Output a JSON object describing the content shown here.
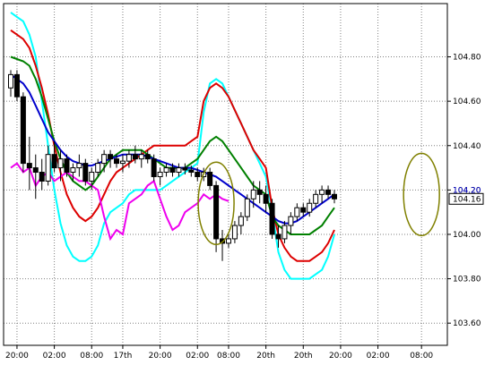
{
  "chart_data": {
    "type": "candlestick",
    "ylim": [
      103.5,
      105.04
    ],
    "y_ticks": [
      {
        "value": 104.8,
        "label": "104.80"
      },
      {
        "value": 104.6,
        "label": "104.60"
      },
      {
        "value": 104.4,
        "label": "104.40"
      },
      {
        "value": 104.2,
        "label": "104.20"
      },
      {
        "value": 104.0,
        "label": "104.00"
      },
      {
        "value": 103.8,
        "label": "103.80"
      },
      {
        "value": 103.6,
        "label": "103.60"
      }
    ],
    "x_ticks": [
      {
        "index": 1,
        "label": "20:00"
      },
      {
        "index": 7,
        "label": "02:00"
      },
      {
        "index": 13,
        "label": "08:00"
      },
      {
        "index": 18,
        "label": "17th"
      },
      {
        "index": 24,
        "label": "20:00"
      },
      {
        "index": 30,
        "label": "02:00"
      },
      {
        "index": 35,
        "label": "08:00"
      },
      {
        "index": 41,
        "label": "20th"
      },
      {
        "index": 47,
        "label": "20th"
      },
      {
        "index": 53,
        "label": "20:00"
      },
      {
        "index": 59,
        "label": "02:00"
      },
      {
        "index": 66,
        "label": "08:00"
      }
    ],
    "n_slots": 70,
    "last_price": {
      "value": 104.16,
      "label": "104.16"
    },
    "reference_price": {
      "value": 104.2,
      "label": "104.20"
    },
    "candles": [
      [
        104.66,
        104.74,
        104.62,
        104.72
      ],
      [
        104.72,
        104.74,
        104.6,
        104.62
      ],
      [
        104.62,
        104.64,
        104.28,
        104.32
      ],
      [
        104.32,
        104.44,
        104.2,
        104.3
      ],
      [
        104.3,
        104.36,
        104.16,
        104.28
      ],
      [
        104.28,
        104.34,
        104.2,
        104.24
      ],
      [
        104.24,
        104.4,
        104.22,
        104.36
      ],
      [
        104.36,
        104.42,
        104.28,
        104.3
      ],
      [
        104.3,
        104.38,
        104.24,
        104.34
      ],
      [
        104.34,
        104.36,
        104.26,
        104.28
      ],
      [
        104.28,
        104.32,
        104.24,
        104.3
      ],
      [
        104.3,
        104.36,
        104.26,
        104.32
      ],
      [
        104.32,
        104.34,
        104.22,
        104.24
      ],
      [
        104.24,
        104.3,
        104.2,
        104.28
      ],
      [
        104.28,
        104.34,
        104.26,
        104.32
      ],
      [
        104.32,
        104.38,
        104.28,
        104.36
      ],
      [
        104.36,
        104.38,
        104.3,
        104.34
      ],
      [
        104.34,
        104.36,
        104.3,
        104.32
      ],
      [
        104.32,
        104.36,
        104.28,
        104.33
      ],
      [
        104.33,
        104.38,
        104.3,
        104.36
      ],
      [
        104.36,
        104.4,
        104.32,
        104.34
      ],
      [
        104.34,
        104.38,
        104.3,
        104.36
      ],
      [
        104.36,
        104.38,
        104.32,
        104.34
      ],
      [
        104.34,
        104.36,
        104.24,
        104.26
      ],
      [
        104.26,
        104.3,
        104.22,
        104.28
      ],
      [
        104.28,
        104.32,
        104.26,
        104.3
      ],
      [
        104.3,
        104.32,
        104.26,
        104.28
      ],
      [
        104.28,
        104.32,
        104.26,
        104.3
      ],
      [
        104.3,
        104.32,
        104.27,
        104.29
      ],
      [
        104.29,
        104.31,
        104.26,
        104.28
      ],
      [
        104.28,
        104.3,
        104.24,
        104.26
      ],
      [
        104.26,
        104.3,
        104.24,
        104.28
      ],
      [
        104.28,
        104.3,
        104.2,
        104.22
      ],
      [
        104.22,
        104.24,
        103.92,
        103.98
      ],
      [
        103.98,
        104.02,
        103.88,
        103.96
      ],
      [
        103.96,
        104.0,
        103.94,
        103.98
      ],
      [
        103.98,
        104.06,
        103.96,
        104.04
      ],
      [
        104.04,
        104.1,
        104.0,
        104.08
      ],
      [
        104.08,
        104.18,
        104.06,
        104.16
      ],
      [
        104.16,
        104.24,
        104.12,
        104.2
      ],
      [
        104.2,
        104.24,
        104.14,
        104.18
      ],
      [
        104.18,
        104.22,
        104.1,
        104.14
      ],
      [
        104.14,
        104.16,
        103.98,
        104.0
      ],
      [
        104.0,
        104.04,
        103.94,
        103.98
      ],
      [
        103.98,
        104.06,
        103.96,
        104.04
      ],
      [
        104.04,
        104.1,
        104.0,
        104.08
      ],
      [
        104.08,
        104.14,
        104.06,
        104.12
      ],
      [
        104.12,
        104.14,
        104.08,
        104.1
      ],
      [
        104.1,
        104.16,
        104.08,
        104.14
      ],
      [
        104.14,
        104.2,
        104.12,
        104.18
      ],
      [
        104.18,
        104.22,
        104.14,
        104.2
      ],
      [
        104.2,
        104.22,
        104.16,
        104.18
      ],
      [
        104.18,
        104.2,
        104.14,
        104.16
      ]
    ],
    "series": [
      {
        "color": "#00ffff",
        "values": [
          105.0,
          104.98,
          104.96,
          104.9,
          104.8,
          104.6,
          104.4,
          104.2,
          104.05,
          103.95,
          103.9,
          103.88,
          103.88,
          103.9,
          103.95,
          104.05,
          104.1,
          104.12,
          104.14,
          104.18,
          104.2,
          104.2,
          104.2,
          104.2,
          104.2,
          104.22,
          104.24,
          104.26,
          104.28,
          104.3,
          104.32,
          104.55,
          104.68,
          104.7,
          104.68,
          104.62,
          104.56,
          104.5,
          104.44,
          104.38,
          104.32,
          104.26,
          104.1,
          103.92,
          103.84,
          103.8,
          103.8,
          103.8,
          103.8,
          103.82,
          103.84,
          103.9,
          104.0
        ]
      },
      {
        "color": "#dd0000",
        "values": [
          104.92,
          104.9,
          104.88,
          104.84,
          104.76,
          104.66,
          104.54,
          104.4,
          104.28,
          104.18,
          104.12,
          104.08,
          104.06,
          104.08,
          104.12,
          104.18,
          104.24,
          104.28,
          104.3,
          104.32,
          104.34,
          104.36,
          104.38,
          104.4,
          104.4,
          104.4,
          104.4,
          104.4,
          104.4,
          104.42,
          104.44,
          104.6,
          104.66,
          104.68,
          104.66,
          104.62,
          104.56,
          104.5,
          104.44,
          104.38,
          104.34,
          104.3,
          104.12,
          104.0,
          103.94,
          103.9,
          103.88,
          103.88,
          103.88,
          103.9,
          103.92,
          103.96,
          104.02
        ]
      },
      {
        "color": "#008000",
        "values": [
          104.8,
          104.79,
          104.78,
          104.76,
          104.7,
          104.62,
          104.52,
          104.42,
          104.34,
          104.28,
          104.24,
          104.22,
          104.2,
          104.22,
          104.26,
          104.3,
          104.34,
          104.36,
          104.38,
          104.38,
          104.38,
          104.38,
          104.36,
          104.34,
          104.32,
          104.3,
          104.3,
          104.3,
          104.3,
          104.32,
          104.34,
          104.38,
          104.42,
          104.44,
          104.42,
          104.38,
          104.34,
          104.3,
          104.26,
          104.22,
          104.2,
          104.18,
          104.08,
          104.04,
          104.02,
          104.0,
          104.0,
          104.0,
          104.0,
          104.02,
          104.04,
          104.08,
          104.12
        ]
      },
      {
        "color": "#0000cc",
        "values": [
          104.72,
          104.7,
          104.68,
          104.64,
          104.58,
          104.52,
          104.46,
          104.42,
          104.38,
          104.35,
          104.33,
          104.32,
          104.31,
          104.31,
          104.32,
          104.33,
          104.34,
          104.35,
          104.36,
          104.36,
          104.36,
          104.36,
          104.35,
          104.34,
          104.33,
          104.32,
          104.31,
          104.3,
          104.3,
          104.3,
          104.29,
          104.28,
          104.27,
          104.26,
          104.24,
          104.22,
          104.2,
          104.18,
          104.16,
          104.14,
          104.12,
          104.1,
          104.08,
          104.06,
          104.05,
          104.05,
          104.06,
          104.08,
          104.1,
          104.12,
          104.14,
          104.16,
          104.18
        ]
      },
      {
        "color": "#ee00ee",
        "values": [
          104.3,
          104.32,
          104.28,
          104.3,
          104.22,
          104.26,
          104.28,
          104.24,
          104.26,
          104.28,
          104.26,
          104.24,
          104.24,
          104.22,
          104.2,
          104.08,
          103.98,
          104.02,
          104.0,
          104.14,
          104.16,
          104.18,
          104.22,
          104.24,
          104.16,
          104.08,
          104.02,
          104.04,
          104.1,
          104.12,
          104.14,
          104.18,
          104.16,
          104.18,
          104.16,
          104.15,
          null,
          null,
          null,
          null,
          null,
          null,
          null,
          null,
          null,
          null,
          null,
          null,
          null,
          null,
          null,
          null,
          null
        ]
      }
    ],
    "annotations": [
      {
        "type": "ellipse",
        "color": "#808000",
        "at_index": 33,
        "at_value": 104.14
      },
      {
        "type": "ellipse",
        "color": "#808000",
        "at_index": 66,
        "at_value": 104.18
      }
    ],
    "grid": true
  }
}
